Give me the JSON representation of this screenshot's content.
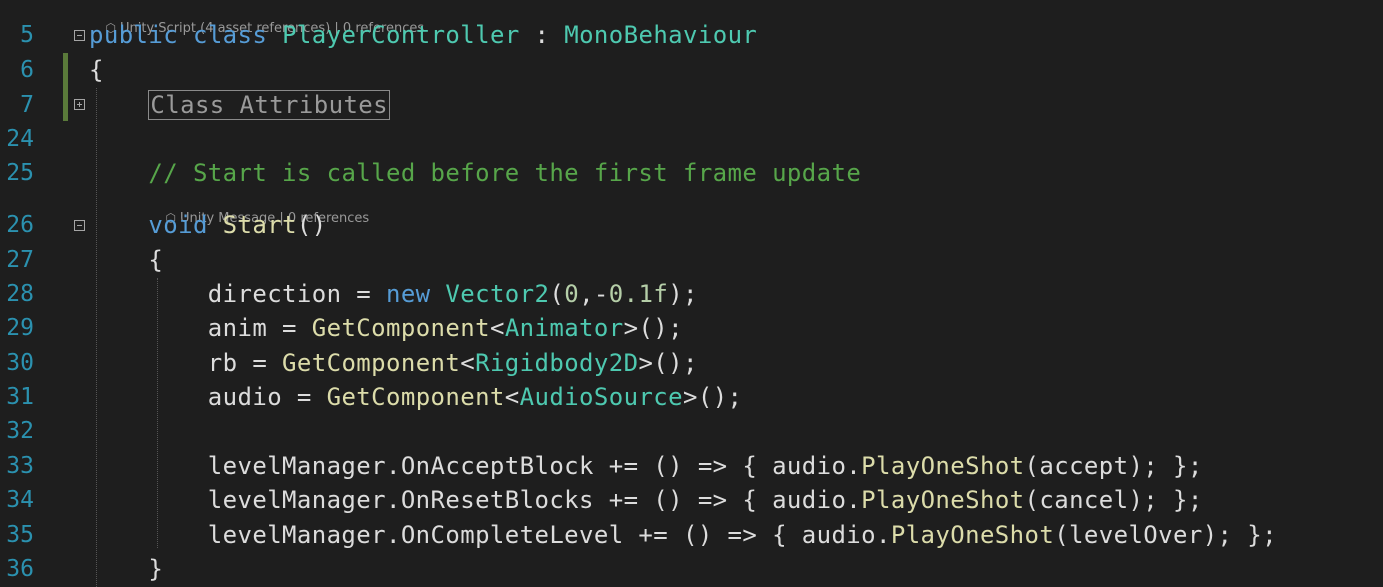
{
  "codelens": {
    "class_lens": "Unity Script (4 asset references) | 0 references",
    "method_lens": "Unity Message | 0 references"
  },
  "lines": [
    {
      "number": "5",
      "tokens": [
        {
          "t": "public",
          "c": "kw"
        },
        {
          "t": " ",
          "c": ""
        },
        {
          "t": "class",
          "c": "kw"
        },
        {
          "t": " ",
          "c": ""
        },
        {
          "t": "PlayerController",
          "c": "ty"
        },
        {
          "t": " : ",
          "c": ""
        },
        {
          "t": "MonoBehaviour",
          "c": "ty"
        }
      ]
    },
    {
      "number": "6",
      "tokens": [
        {
          "t": "{",
          "c": ""
        }
      ]
    },
    {
      "number": "7",
      "tokens": [
        {
          "t": "    ",
          "c": ""
        },
        {
          "t": "Class Attributes",
          "c": "region"
        }
      ]
    },
    {
      "number": "24",
      "tokens": []
    },
    {
      "number": "25",
      "tokens": [
        {
          "t": "    ",
          "c": ""
        },
        {
          "t": "// Start is called before the first frame update",
          "c": "cm"
        }
      ]
    },
    {
      "number": "26",
      "tokens": [
        {
          "t": "    ",
          "c": ""
        },
        {
          "t": "void",
          "c": "kw"
        },
        {
          "t": " ",
          "c": ""
        },
        {
          "t": "Start",
          "c": "fn"
        },
        {
          "t": "()",
          "c": ""
        }
      ]
    },
    {
      "number": "27",
      "tokens": [
        {
          "t": "    {",
          "c": ""
        }
      ]
    },
    {
      "number": "28",
      "tokens": [
        {
          "t": "        direction = ",
          "c": ""
        },
        {
          "t": "new",
          "c": "kw"
        },
        {
          "t": " ",
          "c": ""
        },
        {
          "t": "Vector2",
          "c": "ty"
        },
        {
          "t": "(",
          "c": ""
        },
        {
          "t": "0",
          "c": "nm"
        },
        {
          "t": ",-",
          "c": ""
        },
        {
          "t": "0.1f",
          "c": "nm"
        },
        {
          "t": ");",
          "c": ""
        }
      ]
    },
    {
      "number": "29",
      "tokens": [
        {
          "t": "        anim = ",
          "c": ""
        },
        {
          "t": "GetComponent",
          "c": "fn"
        },
        {
          "t": "<",
          "c": ""
        },
        {
          "t": "Animator",
          "c": "ty"
        },
        {
          "t": ">();",
          "c": ""
        }
      ]
    },
    {
      "number": "30",
      "tokens": [
        {
          "t": "        rb = ",
          "c": ""
        },
        {
          "t": "GetComponent",
          "c": "fn"
        },
        {
          "t": "<",
          "c": ""
        },
        {
          "t": "Rigidbody2D",
          "c": "ty"
        },
        {
          "t": ">();",
          "c": ""
        }
      ]
    },
    {
      "number": "31",
      "tokens": [
        {
          "t": "        audio = ",
          "c": ""
        },
        {
          "t": "GetComponent",
          "c": "fn"
        },
        {
          "t": "<",
          "c": ""
        },
        {
          "t": "AudioSource",
          "c": "ty"
        },
        {
          "t": ">();",
          "c": ""
        }
      ]
    },
    {
      "number": "32",
      "tokens": []
    },
    {
      "number": "33",
      "tokens": [
        {
          "t": "        levelManager.OnAcceptBlock += () => { audio.",
          "c": ""
        },
        {
          "t": "PlayOneShot",
          "c": "fn"
        },
        {
          "t": "(accept); };",
          "c": ""
        }
      ]
    },
    {
      "number": "34",
      "tokens": [
        {
          "t": "        levelManager.OnResetBlocks += () => { audio.",
          "c": ""
        },
        {
          "t": "PlayOneShot",
          "c": "fn"
        },
        {
          "t": "(cancel); };",
          "c": ""
        }
      ]
    },
    {
      "number": "35",
      "tokens": [
        {
          "t": "        levelManager.OnCompleteLevel += () => { audio.",
          "c": ""
        },
        {
          "t": "PlayOneShot",
          "c": "fn"
        },
        {
          "t": "(levelOver); };",
          "c": ""
        }
      ]
    },
    {
      "number": "36",
      "tokens": [
        {
          "t": "    }",
          "c": ""
        }
      ]
    }
  ]
}
